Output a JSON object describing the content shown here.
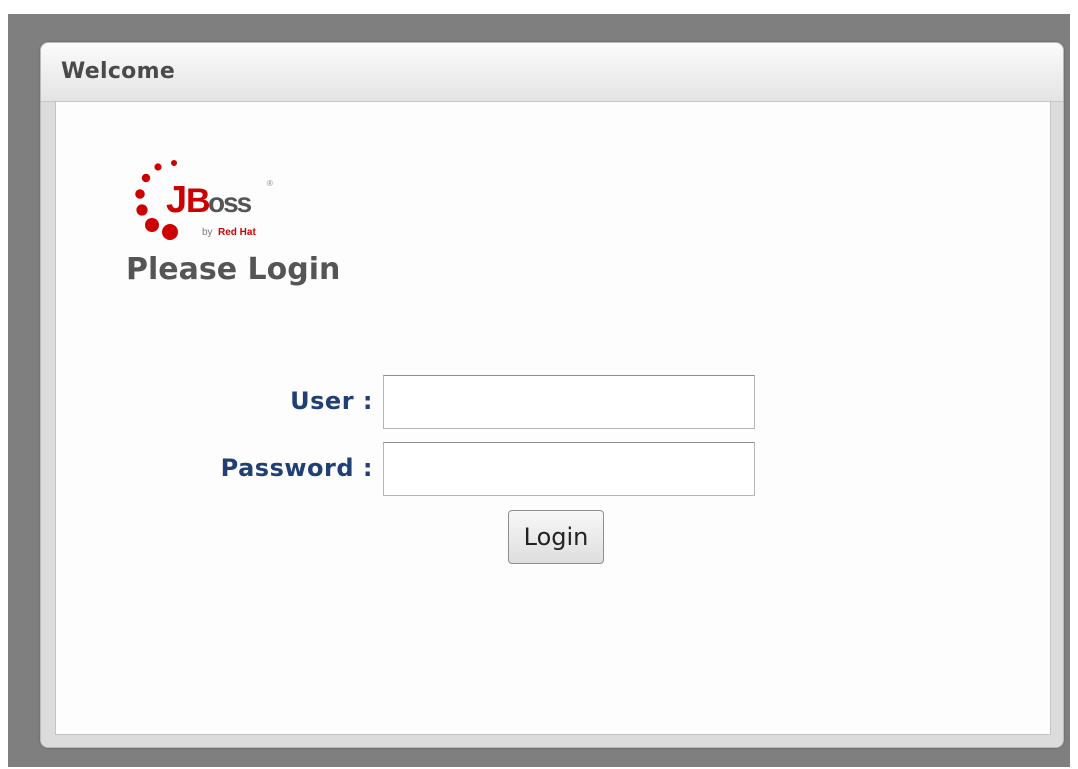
{
  "window": {
    "title": "Welcome"
  },
  "logo": {
    "brand": "JBoss",
    "tagline": "by Red Hat",
    "brand_color": "#cc0000"
  },
  "login": {
    "heading": "Please Login",
    "user_label": "User :",
    "user_value": "",
    "password_label": "Password :",
    "password_value": "",
    "button_label": "Login"
  },
  "colors": {
    "label": "#1f3f75",
    "heading": "#555555",
    "backdrop": "#7f7f7f"
  }
}
